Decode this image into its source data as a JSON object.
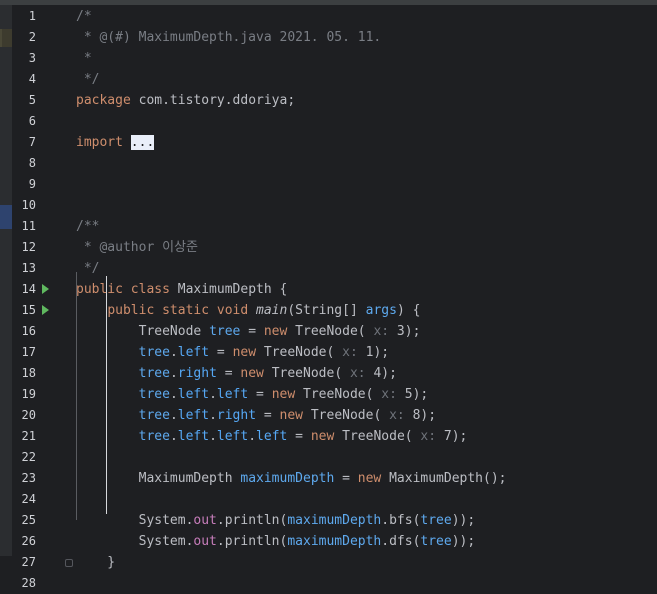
{
  "lines": [
    {
      "n": "1",
      "html": "<span class='cm'>/*</span>"
    },
    {
      "n": "2",
      "html": "<span class='cm'> * @(#) MaximumDepth.java 2021. 05. 11.</span>"
    },
    {
      "n": "3",
      "html": "<span class='cm'> *</span>"
    },
    {
      "n": "4",
      "html": "<span class='cm'> */</span>"
    },
    {
      "n": "5",
      "html": "<span class='kw'>package</span> com.tistory.ddoriya;"
    },
    {
      "n": "6",
      "html": ""
    },
    {
      "n": "7",
      "html": "<span class='kw'>import</span> <span class='sel'>...</span>"
    },
    {
      "n": "8",
      "html": ""
    },
    {
      "n": "9",
      "html": ""
    },
    {
      "n": "10",
      "html": ""
    },
    {
      "n": "11",
      "html": "<span class='cm'>/**</span>"
    },
    {
      "n": "12",
      "html": "<span class='cm'> * </span><span class='cm'>@author</span><span class='cm'> 이상준</span>"
    },
    {
      "n": "13",
      "html": "<span class='cm'> */</span>"
    },
    {
      "n": "14",
      "html": "<span class='kw'>public class</span> MaximumDepth {"
    },
    {
      "n": "15",
      "html": "    <span class='kw'>public static void</span> <span class='fn'>main</span>(String[] <span class='var'>args</span>) {"
    },
    {
      "n": "16",
      "html": "        TreeNode <span class='var'>tree</span> = <span class='kw'>new</span> TreeNode( <span class='hint'>x:</span> 3);"
    },
    {
      "n": "17",
      "html": "        <span class='var'>tree</span>.<span class='fld'>left</span> = <span class='kw'>new</span> TreeNode( <span class='hint'>x:</span> 1);"
    },
    {
      "n": "18",
      "html": "        <span class='var'>tree</span>.<span class='fld'>right</span> = <span class='kw'>new</span> TreeNode( <span class='hint'>x:</span> 4);"
    },
    {
      "n": "19",
      "html": "        <span class='var'>tree</span>.<span class='fld'>left</span>.<span class='fld'>left</span> = <span class='kw'>new</span> TreeNode( <span class='hint'>x:</span> 5);"
    },
    {
      "n": "20",
      "html": "        <span class='var'>tree</span>.<span class='fld'>left</span>.<span class='fld'>right</span> = <span class='kw'>new</span> TreeNode( <span class='hint'>x:</span> 8);"
    },
    {
      "n": "21",
      "html": "        <span class='var'>tree</span>.<span class='fld'>left</span>.<span class='fld'>left</span>.<span class='fld'>left</span> = <span class='kw'>new</span> TreeNode( <span class='hint'>x:</span> 7);"
    },
    {
      "n": "22",
      "html": ""
    },
    {
      "n": "23",
      "html": "        MaximumDepth <span class='var'>maximumDepth</span> = <span class='kw'>new</span> MaximumDepth();"
    },
    {
      "n": "24",
      "html": ""
    },
    {
      "n": "25",
      "html": "        System.<span class='stat'>out</span>.println(<span class='var'>maximumDepth</span>.bfs(<span class='var'>tree</span>));"
    },
    {
      "n": "26",
      "html": "        System.<span class='stat'>out</span>.println(<span class='var'>maximumDepth</span>.dfs(<span class='var'>tree</span>));"
    },
    {
      "n": "27",
      "html": "    }"
    },
    {
      "n": "28",
      "html": ""
    }
  ],
  "run_gutter_lines": [
    "14",
    "15"
  ],
  "fold_lines": [
    "1",
    "4",
    "7",
    "11",
    "13",
    "15",
    "27"
  ],
  "colors": {
    "background": "#1e1f22",
    "keyword": "#cf8e6d",
    "comment": "#7a7e85",
    "field": "#56a8f5",
    "static": "#c77dbb",
    "hint": "#6f737a",
    "run": "#5fb85f"
  }
}
